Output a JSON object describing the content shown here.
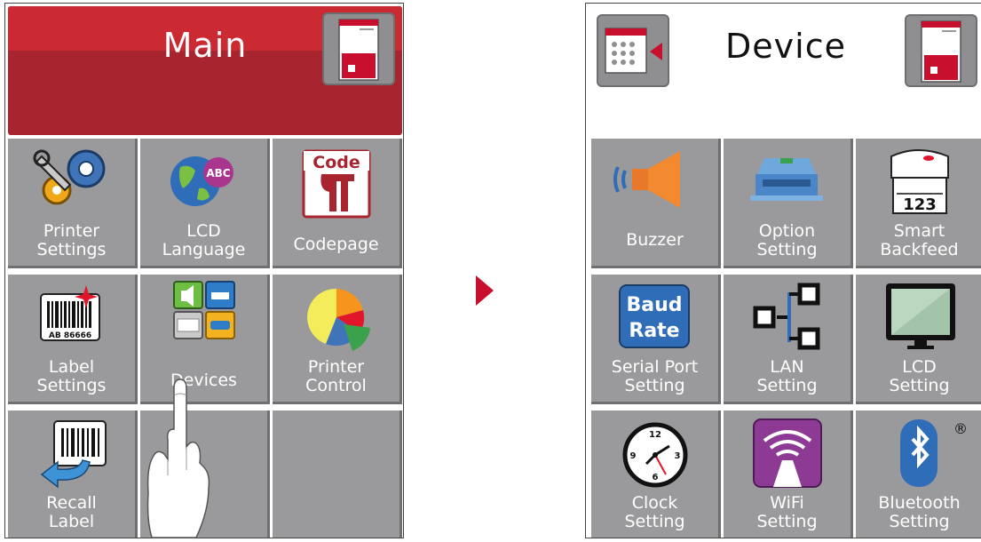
{
  "left_screen": {
    "title": "Main",
    "tiles": [
      {
        "label": [
          "Printer",
          "Settings"
        ],
        "icon": "gears-wrench-icon"
      },
      {
        "label": [
          "LCD",
          "Language"
        ],
        "icon": "globe-abc-icon"
      },
      {
        "label": [
          "Codepage",
          ""
        ],
        "icon": "codepage-icon"
      },
      {
        "label": [
          "Label",
          "Settings"
        ],
        "icon": "barcode-label-icon"
      },
      {
        "label": [
          "Devices",
          ""
        ],
        "icon": "devices-icon"
      },
      {
        "label": [
          "Printer",
          "Control"
        ],
        "icon": "pie-chart-icon"
      },
      {
        "label": [
          "Recall",
          "Label"
        ],
        "icon": "recall-label-icon"
      },
      {
        "label": [
          "",
          ""
        ],
        "icon": ""
      },
      {
        "label": [
          "",
          ""
        ],
        "icon": ""
      }
    ],
    "barcode_text": "AB 86666",
    "codepage_icon_text": "Code"
  },
  "right_screen": {
    "title": "Device",
    "tiles": [
      {
        "label": [
          "",
          "Buzzer"
        ],
        "icon": "speaker-icon"
      },
      {
        "label": [
          "Option",
          "Setting"
        ],
        "icon": "option-module-icon"
      },
      {
        "label": [
          "Smart",
          "Backfeed"
        ],
        "icon": "smart-backfeed-icon"
      },
      {
        "label": [
          "Serial Port",
          "Setting"
        ],
        "icon": "baud-rate-icon"
      },
      {
        "label": [
          "LAN",
          "Setting"
        ],
        "icon": "lan-icon"
      },
      {
        "label": [
          "LCD",
          "Setting"
        ],
        "icon": "monitor-icon"
      },
      {
        "label": [
          "Clock",
          "Setting"
        ],
        "icon": "clock-icon"
      },
      {
        "label": [
          "WiFi",
          "Setting"
        ],
        "icon": "wifi-icon"
      },
      {
        "label": [
          "Bluetooth",
          "Setting"
        ],
        "icon": "bluetooth-icon"
      }
    ],
    "baud_line1": "Baud",
    "baud_line2": "Rate",
    "backfeed_text": "123",
    "registered_mark": "®",
    "clock_numbers": [
      "12",
      "3",
      "6",
      "9"
    ]
  },
  "colors": {
    "header_red": "#a8242f",
    "tile_gray": "#9a9a9c",
    "arrow_red": "#c8102e"
  }
}
